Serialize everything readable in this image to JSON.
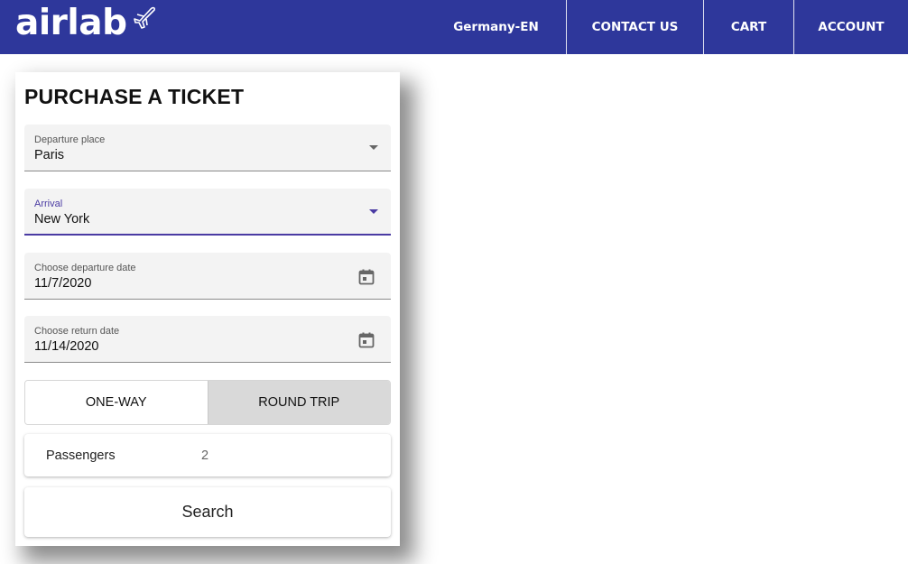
{
  "header": {
    "logo_text": "airlab",
    "nav": {
      "language": "Germany-EN",
      "contact": "CONTACT US",
      "cart": "CART",
      "account": "ACCOUNT"
    },
    "color": "#2e379b"
  },
  "form": {
    "title": "PURCHASE A TICKET",
    "departure": {
      "label": "Departure place",
      "value": "Paris"
    },
    "arrival": {
      "label": "Arrival",
      "value": "New York"
    },
    "departure_date": {
      "label": "Choose departure date",
      "value": "11/7/2020"
    },
    "return_date": {
      "label": "Choose return date",
      "value": "11/14/2020"
    },
    "trip_type": {
      "one_way": "ONE-WAY",
      "round_trip": "ROUND TRIP",
      "selected": "ROUND TRIP"
    },
    "passengers": {
      "label": "Passengers",
      "value": "2"
    },
    "search_label": "Search"
  },
  "icons": [
    "plane-icon",
    "chevron-down-icon",
    "calendar-icon"
  ],
  "accent_color": "#4a3ba3"
}
